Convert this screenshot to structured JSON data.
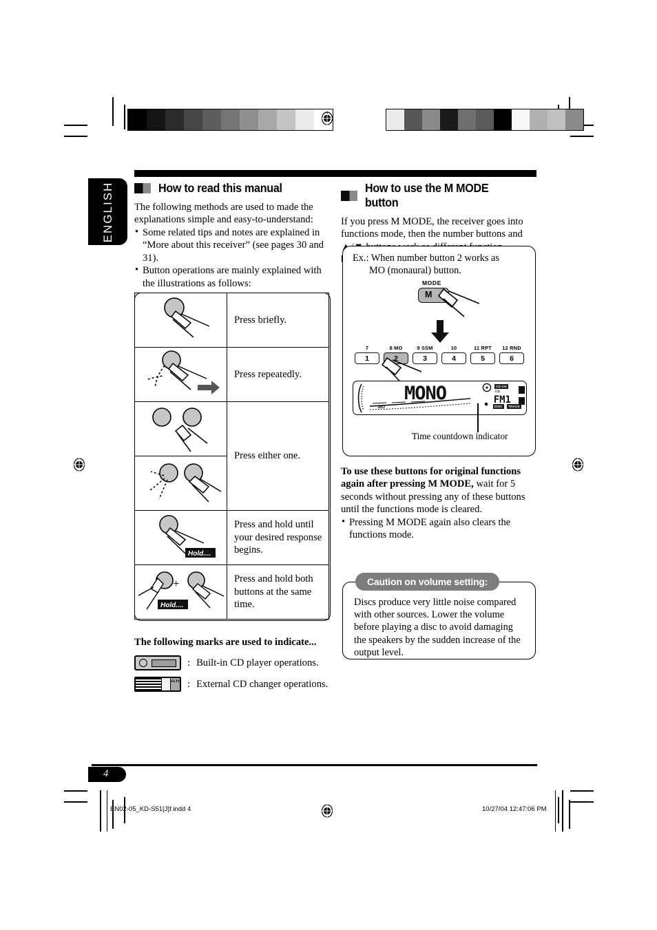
{
  "sidebar_tab": {
    "label": "ENGLISH"
  },
  "left_column": {
    "heading": "How to read this manual",
    "intro": "The following methods are used to made the explanations simple and easy-to-understand:",
    "bullets": [
      "Some related tips and notes are explained in “More about this receiver” (see pages 30 and 31).",
      "Button operations are mainly explained with the illustrations as follows:"
    ],
    "gesture_table": [
      {
        "icon": "press-briefly",
        "desc": "Press briefly."
      },
      {
        "icon": "press-repeatedly",
        "desc": "Press repeatedly."
      },
      {
        "icon": "press-either-one-a",
        "desc": "Press either one."
      },
      {
        "icon": "press-either-one-b",
        "desc": ""
      },
      {
        "icon": "press-and-hold",
        "desc": "Press and hold until your desired response begins.",
        "badge": "Hold...."
      },
      {
        "icon": "press-and-hold-both",
        "desc": "Press and hold both buttons at the same time.",
        "badge": "Hold....",
        "plus": "+"
      }
    ],
    "marks_heading": "The following marks are used to indicate...",
    "marks": [
      {
        "icon": "built-in-cd-player-icon",
        "separator": ":",
        "desc": "Built-in CD player operations."
      },
      {
        "icon": "external-cd-changer-icon",
        "separator": ":",
        "desc": "External CD changer operations."
      }
    ]
  },
  "right_column": {
    "heading": "How to use the M MODE button",
    "intro": "If you press M MODE, the receiver goes into functions mode, then the number buttons and ▲/▼ buttons work as different function buttons.",
    "illustration": {
      "caption_line1": "Ex.: When number button 2 works as",
      "caption_line2": "MO (monaural) button.",
      "mode_label": "MODE",
      "mode_button": "M",
      "number_buttons": [
        {
          "top_label": "7",
          "key": "1",
          "highlighted": false
        },
        {
          "top_label": "8 MO",
          "key": "2",
          "highlighted": true
        },
        {
          "top_label": "9 SSM",
          "key": "3",
          "highlighted": false
        },
        {
          "top_label": "10",
          "key": "4",
          "highlighted": false
        },
        {
          "top_label": "11 RPT",
          "key": "5",
          "highlighted": false
        },
        {
          "top_label": "12 RND",
          "key": "6",
          "highlighted": false
        }
      ],
      "display": {
        "main_text": "MONO",
        "band_text": "FM1",
        "small_mo": "MO",
        "tags": [
          "CD-CH",
          "CD",
          "DISC",
          "TRACK"
        ]
      },
      "callout": "Time countdown indicator"
    },
    "note_bold": "To use these buttons for original functions again after pressing M MODE,",
    "note_rest": " wait for 5 seconds without pressing any of these buttons until the functions mode is cleared.",
    "note_bullets": [
      "Pressing M MODE again also clears the functions mode."
    ]
  },
  "caution_box": {
    "title": "Caution on volume setting:",
    "body": "Discs produce very little noise compared with other sources. Lower the volume before playing a disc to avoid damaging the speakers by the sudden increase of the output level."
  },
  "footer": {
    "page_number": "4",
    "file_name": "EN02-05_KD-S51[J]f.indd   4",
    "timestamp": "10/27/04   12:47:06 PM"
  },
  "print_marks": {
    "calibration_left": [
      "#000000",
      "#141414",
      "#2b2b2b",
      "#464646",
      "#5e5e5e",
      "#757575",
      "#8f8f8f",
      "#a9a9a9",
      "#c4c4c4",
      "#ebebeb",
      "#ffffff"
    ],
    "calibration_right": [
      "#ebebeb",
      "#565656",
      "#8a8a8a",
      "#1a1a1a",
      "#6e6e6e",
      "#5a5a5a",
      "#000000",
      "#f7f7f7",
      "#b0b0b0",
      "#c0c0c0",
      "#8a8a8a"
    ]
  }
}
